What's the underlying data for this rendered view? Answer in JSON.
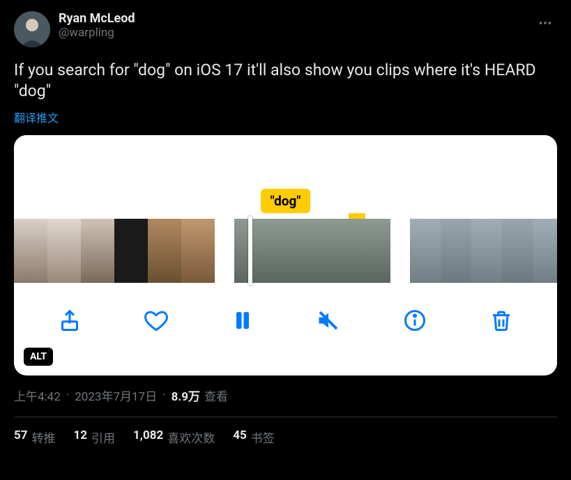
{
  "author": {
    "display_name": "Ryan McLeod",
    "handle": "@warpling"
  },
  "body_text": "If you search for \"dog\" on iOS 17 it'll also show you clips where it's HEARD \"dog\"",
  "translate_label": "翻译推文",
  "media": {
    "dog_label": "\"dog\"",
    "alt_badge": "ALT",
    "controls": {
      "share": "share-icon",
      "like": "heart-icon",
      "pause": "pause-icon",
      "mute": "mute-icon",
      "info": "info-icon",
      "delete": "trash-icon"
    }
  },
  "meta": {
    "time": "上午4:42",
    "date": "2023年7月17日",
    "views_count": "8.9万",
    "views_label": "查看"
  },
  "stats": {
    "retweets": {
      "count": "57",
      "label": "转推"
    },
    "quotes": {
      "count": "12",
      "label": "引用"
    },
    "likes": {
      "count": "1,082",
      "label": "喜欢次数"
    },
    "bookmarks": {
      "count": "45",
      "label": "书签"
    }
  }
}
